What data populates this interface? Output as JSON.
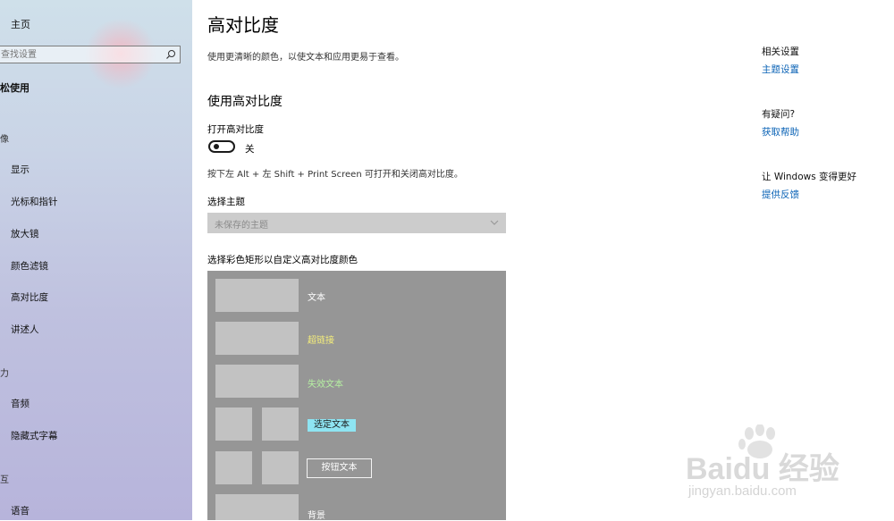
{
  "sidebar": {
    "home": "主页",
    "search_placeholder": "查找设置",
    "ease_heading": "松使用",
    "categories": {
      "vision": "像",
      "hearing": "力",
      "interaction": "互"
    },
    "items": {
      "display": "显示",
      "cursor": "光标和指针",
      "magnifier": "放大镜",
      "color_filters": "颜色滤镜",
      "high_contrast": "高对比度",
      "narrator": "讲述人",
      "audio": "音频",
      "captions": "隐藏式字幕",
      "speech": "语音"
    }
  },
  "main": {
    "title": "高对比度",
    "subtitle": "使用更清晰的颜色，以使文本和应用更易于查看。",
    "section_title": "使用高对比度",
    "toggle_label": "打开高对比度",
    "toggle_state": "关",
    "shortcut": "按下左 Alt + 左 Shift + Print Screen 可打开和关闭高对比度。",
    "theme_label": "选择主题",
    "theme_value": "未保存的主题",
    "rect_label": "选择彩色矩形以自定义高对比度颜色",
    "palette": {
      "text": "文本",
      "hyperlink": "超链接",
      "disabled_text": "失效文本",
      "selected_text": "选定文本",
      "button_text": "按钮文本",
      "background": "背景"
    },
    "colors": {
      "hyperlink": "#f5ee7a",
      "disabled": "#b6f0a2",
      "selected_bg": "#8ee4f2"
    }
  },
  "right": {
    "related_heading": "相关设置",
    "theme_settings": "主题设置",
    "question_heading": "有疑问?",
    "get_help": "获取帮助",
    "improve_heading": "让 Windows 变得更好",
    "feedback": "提供反馈"
  },
  "watermark": {
    "brand": "Baidu 经验",
    "url": "jingyan.baidu.com"
  }
}
